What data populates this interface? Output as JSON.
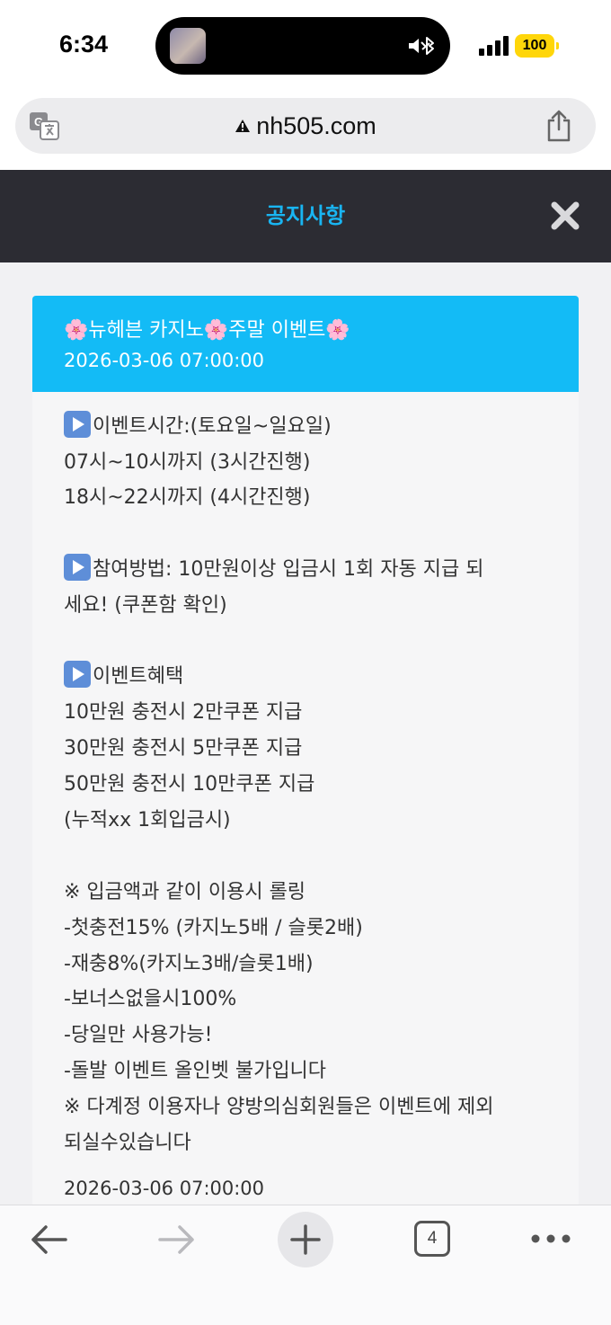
{
  "status_bar": {
    "time": "6:34",
    "battery": "100",
    "battery_color": "#ffd60a"
  },
  "url_bar": {
    "url": "nh505.com",
    "icons": [
      "translate-icon",
      "warning-icon",
      "share-icon"
    ]
  },
  "modal": {
    "title": "공지사항",
    "title_color": "#19b5f2",
    "header_bg": "#2c2c33",
    "close_icon": "close-icon"
  },
  "notice": {
    "title": "🌸뉴헤븐 카지노🌸주말 이벤트🌸",
    "date": "2026-03-06 07:00:00",
    "accent": "#13bbf6",
    "lines": [
      "이벤트시간:(토요일~일요일)",
      "07시~10시까지 (3시간진행)",
      "18시~22시까지 (4시간진행)",
      "",
      "참여방법: 10만원이상 입금시 1회 자동 지급 되",
      "세요! (쿠폰함 확인)",
      "",
      "이벤트혜택",
      "10만원 충전시 2만쿠폰 지급",
      "30만원 충전시 5만쿠폰 지급",
      "50만원 충전시 10만쿠폰 지급",
      "(누적xx 1회입금시)",
      "",
      "※ 입금액과 같이 이용시 롤링",
      "-첫충전15% (카지노5배 / 슬롯2배)",
      "-재충8%(카지노3배/슬롯1배)",
      "-보너스없을시100%",
      "-당일만 사용가능!",
      "-돌발 이벤트 올인벳 불가입니다",
      "※ 다계정 이용자나 양방의심회원들은 이벤트에 제외",
      "되실수있습니다"
    ],
    "footer_date": "2026-03-06 07:00:00"
  },
  "bottom_bar": {
    "tab_count": "4",
    "icons": [
      "back-arrow-icon",
      "forward-arrow-icon",
      "plus-icon",
      "tabs-icon",
      "more-icon"
    ]
  }
}
